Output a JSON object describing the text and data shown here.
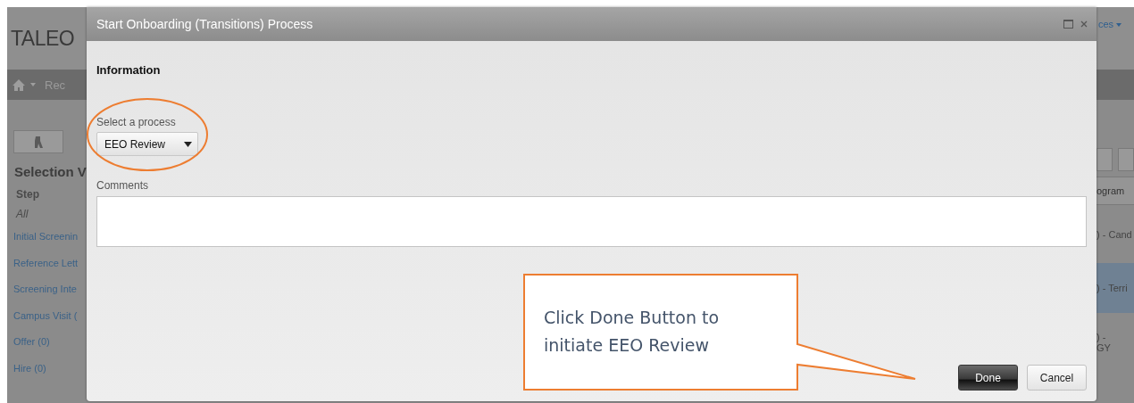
{
  "background": {
    "logo": "TALEO",
    "nav_item": "Rec",
    "header_link": "ces",
    "panel_title": "Selection V",
    "step_header": "Step",
    "step_filter": "All",
    "steps": [
      "Initial Screenin",
      "Reference Lett",
      "Screening Inte",
      "Campus Visit (",
      "Offer (0)",
      "Hire (0)"
    ],
    "column_header": "ogram",
    "rows": [
      {
        "lines": [
          ") - Cand"
        ],
        "selected": false
      },
      {
        "lines": [
          ") - Terri"
        ],
        "selected": true
      },
      {
        "lines": [
          ") -",
          "GY"
        ],
        "selected": false
      }
    ]
  },
  "dialog": {
    "title": "Start Onboarding (Transitions) Process",
    "section": "Information",
    "process_label": "Select a process",
    "process_value": "EEO Review",
    "comments_label": "Comments",
    "buttons": [
      {
        "label": "Done",
        "kind": "primary"
      },
      {
        "label": "Cancel",
        "kind": "secondary"
      }
    ]
  },
  "callout": {
    "text": "Click Done Button to initiate EEO Review"
  }
}
